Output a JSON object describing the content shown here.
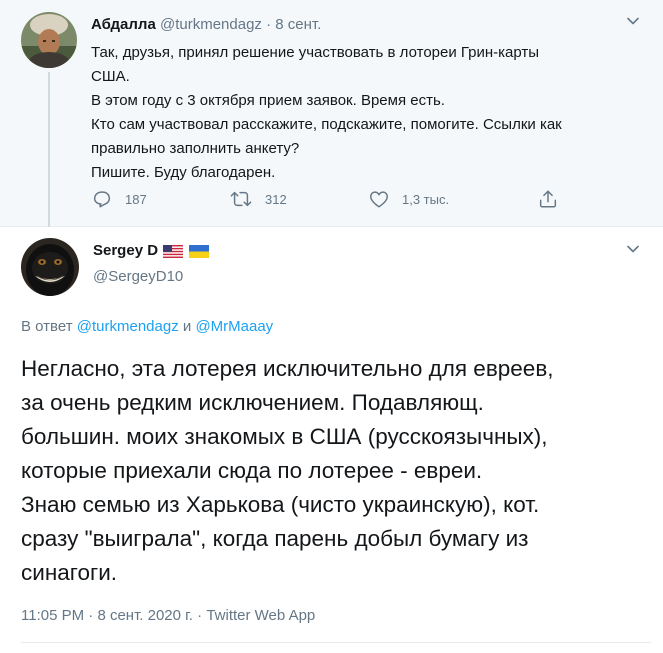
{
  "parent_tweet": {
    "author_name": "Абдалла",
    "author_handle": "@turkmendagz",
    "separator": "·",
    "date": "8 сент.",
    "lines": [
      "Так, друзья, принял решение участвовать в лотореи Грин-карты",
      "США.",
      "В этом году с 3 октября прием заявок. Время есть.",
      "Кто сам участвовал расскажите, подскажите, помогите. Ссылки как",
      "правильно заполнить анкету?",
      "Пишите. Буду благодарен."
    ],
    "actions": {
      "replies": "187",
      "retweets": "312",
      "likes": "1,3 тыс."
    },
    "icons": [
      "reply-icon",
      "retweet-icon",
      "like-icon",
      "share-icon",
      "chevron-down-icon"
    ]
  },
  "main_tweet": {
    "author_name": "Sergey D",
    "author_handle": "@SergeyD10",
    "flags": [
      "us-flag-icon",
      "ukraine-flag-icon"
    ],
    "reply_prefix": "В ответ",
    "reply_to_1": "@turkmendagz",
    "reply_conjunction": "и",
    "reply_to_2": "@MrMaaay",
    "lines": [
      "Негласно, эта лотерея исключительно для евреев,",
      "за очень редким исключением. Подавляющ.",
      "большин. моих знакомых в США (русскоязычных),",
      "которые приехали сюда по лотерее - евреи.",
      "Знаю семью из Харькова (чисто украинскую), кот.",
      "сразу \"выиграла\", когда парень добыл бумагу из",
      "синагоги."
    ],
    "time": "11:05 PM",
    "date": "8 сент. 2020 г.",
    "source": "Twitter Web App",
    "meta_separator": "·"
  },
  "colors": {
    "text": "#14171a",
    "secondary": "#657786",
    "accent": "#1da1f2",
    "parent_background": "#f5f8fa",
    "divider": "#e6ecf0"
  }
}
